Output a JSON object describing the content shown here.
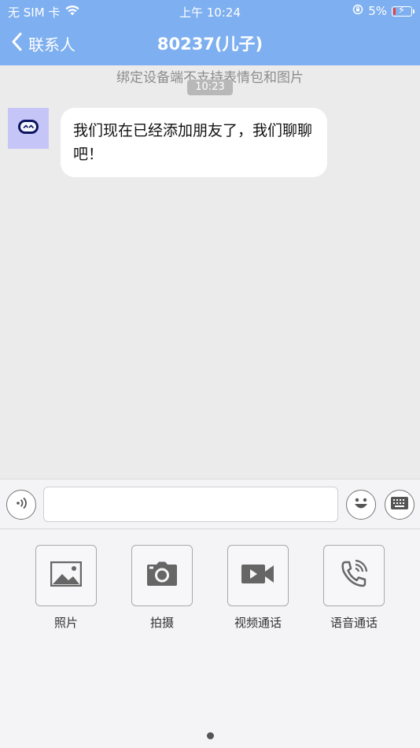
{
  "status": {
    "carrier": "无 SIM 卡",
    "time": "上午 10:24",
    "battery": "5%"
  },
  "nav": {
    "back_label": "联系人",
    "title": "80237(儿子)"
  },
  "chat": {
    "notice": "绑定设备端不支持表情包和图片",
    "time_label": "10:23",
    "messages": [
      {
        "text": "我们现在已经添加朋友了，我们聊聊吧！"
      }
    ]
  },
  "input": {
    "value": "",
    "placeholder": ""
  },
  "tools": [
    {
      "label": "照片",
      "icon": "photo-icon"
    },
    {
      "label": "拍摄",
      "icon": "camera-icon"
    },
    {
      "label": "视频通话",
      "icon": "video-call-icon"
    },
    {
      "label": "语音通话",
      "icon": "voice-call-icon"
    }
  ],
  "colors": {
    "header": "#7eaff0",
    "background": "#ebebeb",
    "avatar": "#c6c5f8",
    "battery_low": "#e5473c"
  },
  "pager": {
    "current": 1,
    "total": 1
  }
}
